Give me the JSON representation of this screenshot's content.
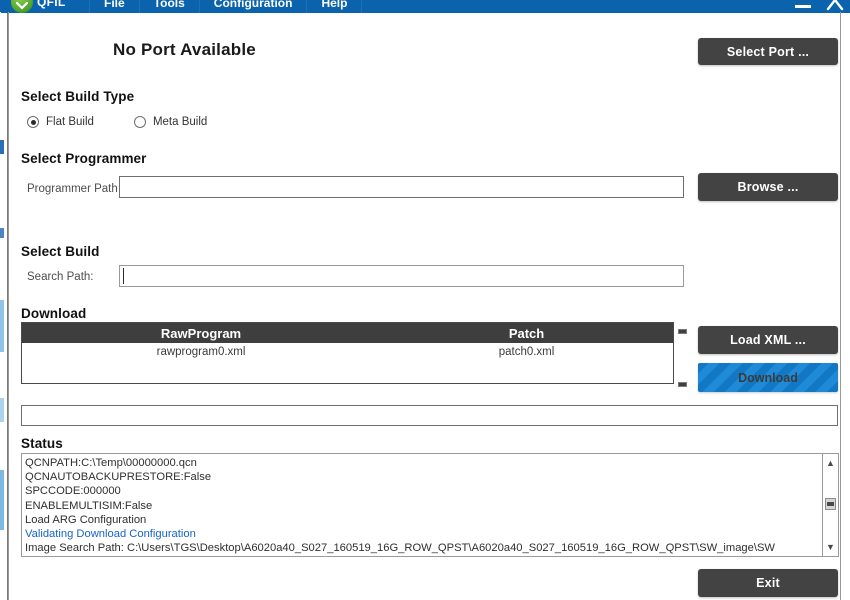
{
  "window": {
    "app_name": "QFIL",
    "logo_icon": "green-chevron-logo",
    "minimize_icon": "minimize-icon",
    "close_icon": "close-icon"
  },
  "menu": {
    "items": [
      {
        "label": "File",
        "name": "menu-file"
      },
      {
        "label": "Tools",
        "name": "menu-tools"
      },
      {
        "label": "Configuration",
        "name": "menu-configuration"
      },
      {
        "label": "Help",
        "name": "menu-help"
      }
    ]
  },
  "header": {
    "port_status": "No Port Available",
    "select_port_label": "Select Port ..."
  },
  "build_type": {
    "title": "Select Build Type",
    "options": [
      {
        "label": "Flat Build",
        "selected": true
      },
      {
        "label": "Meta Build",
        "selected": false
      }
    ]
  },
  "programmer": {
    "title": "Select Programmer",
    "path_label": "Programmer Path",
    "path_value": "",
    "path_placeholder": "",
    "browse_label": "Browse ..."
  },
  "build": {
    "title": "Select Build",
    "search_label": "Search Path:",
    "search_value": "",
    "search_placeholder": ""
  },
  "download": {
    "title": "Download",
    "columns": [
      "RawProgram",
      "Patch"
    ],
    "rows": [
      {
        "rawprogram": "rawprogram0.xml",
        "patch": "patch0.xml"
      }
    ],
    "load_xml_label": "Load XML ...",
    "download_label": "Download",
    "splitter_icon": "splitter-handle-icon"
  },
  "progress": {
    "value": 0,
    "text": ""
  },
  "status": {
    "title": "Status",
    "lines": [
      {
        "text": "QCNPATH:C:\\Temp\\00000000.qcn",
        "highlight": false
      },
      {
        "text": "QCNAUTOBACKUPRESTORE:False",
        "highlight": false
      },
      {
        "text": "SPCCODE:000000",
        "highlight": false
      },
      {
        "text": "ENABLEMULTISIM:False",
        "highlight": false
      },
      {
        "text": "Load ARG Configuration",
        "highlight": false
      },
      {
        "text": "Validating Download Configuration",
        "highlight": true
      },
      {
        "text": "Image Search Path: C:\\Users\\TGS\\Desktop\\A6020a40_S027_160519_16G_ROW_QPST\\A6020a40_S027_160519_16G_ROW_QPST\\SW_image\\SW",
        "highlight": false
      }
    ],
    "scroll_up_icon": "chevron-up-icon",
    "scroll_down_icon": "chevron-down-icon",
    "scroll_thumb_icon": "scrollbar-thumb"
  },
  "footer": {
    "exit_label": "Exit"
  },
  "colors": {
    "titlebar_blue": "#0a63ac",
    "button_dark": "#434343",
    "download_blue": "#1278c4",
    "table_header": "#3e3e3e",
    "log_highlight": "#1464c8"
  }
}
